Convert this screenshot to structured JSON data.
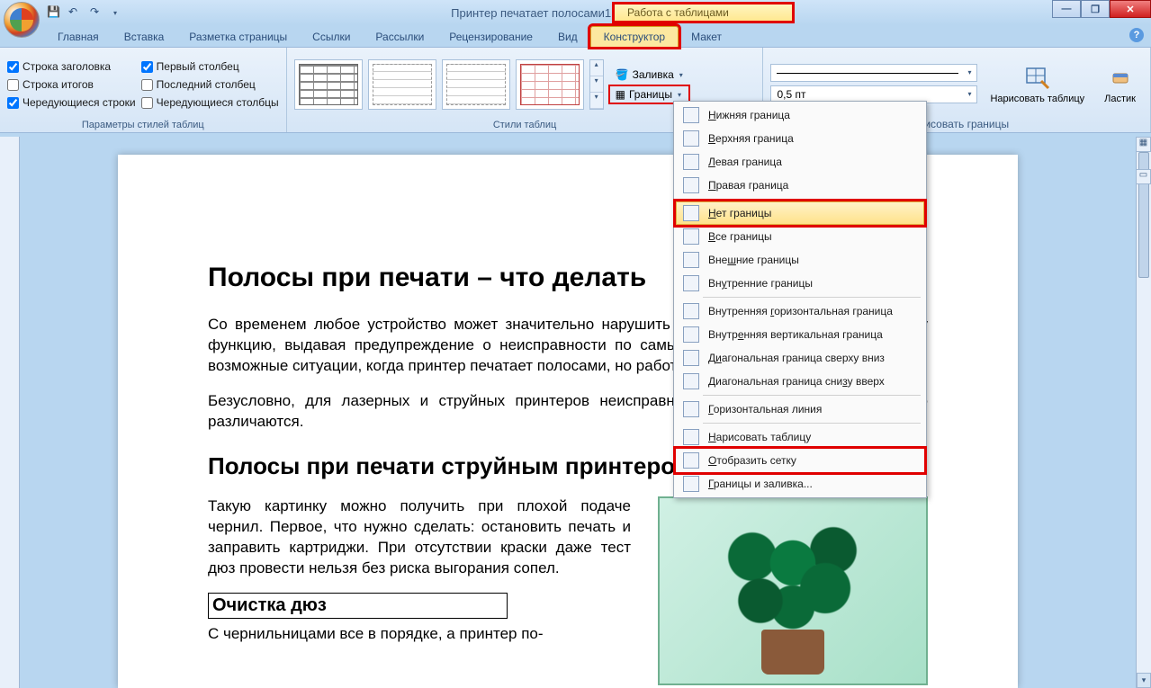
{
  "title": "Принтер печатает полосами1 - Microsoft Word",
  "context_tab": "Работа с таблицами",
  "tabs": [
    "Главная",
    "Вставка",
    "Разметка страницы",
    "Ссылки",
    "Рассылки",
    "Рецензирование",
    "Вид",
    "Конструктор",
    "Макет"
  ],
  "active_tab_index": 7,
  "ribbon": {
    "style_options": {
      "label": "Параметры стилей таблиц",
      "left": [
        {
          "label": "Строка заголовка",
          "checked": true
        },
        {
          "label": "Строка итогов",
          "checked": false
        },
        {
          "label": "Чередующиеся строки",
          "checked": true
        }
      ],
      "right": [
        {
          "label": "Первый столбец",
          "checked": true
        },
        {
          "label": "Последний столбец",
          "checked": false
        },
        {
          "label": "Чередующиеся столбцы",
          "checked": false
        }
      ]
    },
    "table_styles_label": "Стили таблиц",
    "fill_label": "Заливка",
    "borders_label": "Границы",
    "weight_value": "0,5 пт",
    "draw_borders_label": "Нарисовать границы",
    "draw_table_label": "Нарисовать таблицу",
    "eraser_label": "Ластик"
  },
  "borders_menu": [
    {
      "label": "Нижняя граница",
      "u": "Н"
    },
    {
      "label": "Верхняя граница",
      "u": "В"
    },
    {
      "label": "Левая граница",
      "u": "Л"
    },
    {
      "label": "Правая граница",
      "u": "П"
    },
    {
      "sep": true
    },
    {
      "label": "Нет границы",
      "u": "Н",
      "hover": true,
      "boxed": true
    },
    {
      "label": "Все границы",
      "u": "В"
    },
    {
      "label": "Внешние границы",
      "u": "ш"
    },
    {
      "label": "Внутренние границы",
      "u": "у"
    },
    {
      "sep": true
    },
    {
      "label": "Внутренняя горизонтальная граница",
      "u": "г"
    },
    {
      "label": "Внутренняя вертикальная граница",
      "u": "е"
    },
    {
      "label": "Диагональная граница сверху вниз",
      "u": "и"
    },
    {
      "label": "Диагональная граница снизу вверх",
      "u": "з"
    },
    {
      "sep": true
    },
    {
      "label": "Горизонтальная линия",
      "u": "Г"
    },
    {
      "sep": true
    },
    {
      "label": "Нарисовать таблицу",
      "u": "Н"
    },
    {
      "label": "Отобразить сетку",
      "u": "О",
      "boxed": true
    },
    {
      "label": "Границы и заливка...",
      "u": "Г"
    }
  ],
  "document": {
    "h1": "Полосы при печати – что делать",
    "p1": "Со временем любое устройство может значительно нарушить работу или же заблокировать эту функцию, выдавая предупреждение о неисправности по самым разным причинам. Рассмотрим возможные ситуации, когда принтер печатает полосами, но работать не отказывается.",
    "p2": "Безусловно, для лазерных и струйных принтеров неисправности и их решения существенно различаются.",
    "h2": "Полосы при печати струйным принтером",
    "p3": "Такую картинку можно получить при плохой подаче чернил. Первое, что нужно сделать: остановить печать и заправить картриджи. При отсутствии краски даже тест дюз провести нельзя без риска выгорания сопел.",
    "h3": "Очистка дюз",
    "p4": "С чернильницами все в порядке, а принтер по-"
  }
}
